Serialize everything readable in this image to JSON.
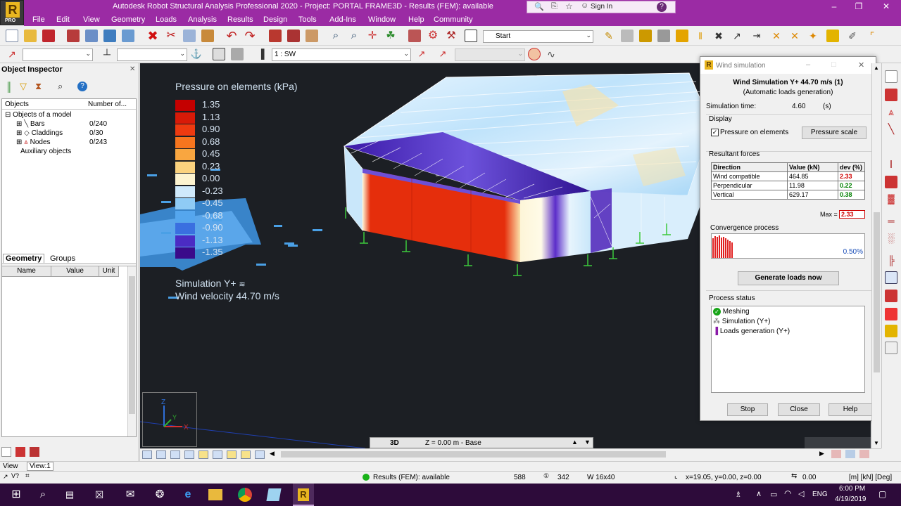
{
  "app": {
    "title": "Autodesk Robot Structural Analysis Professional 2020 - Project: PORTAL FRAME3D - Results (FEM): available",
    "logo_letter": "R",
    "logo_sub": "PRO",
    "sign_in": "Sign In",
    "accent": "#9b2ba4"
  },
  "menu": [
    "File",
    "Edit",
    "View",
    "Geometry",
    "Loads",
    "Analysis",
    "Results",
    "Design",
    "Tools",
    "Add-Ins",
    "Window",
    "Help",
    "Community"
  ],
  "toolbar": {
    "layout_combo": "Start",
    "case_combo": "1 : SW"
  },
  "object_inspector": {
    "title": "Object Inspector",
    "col_objects": "Objects",
    "col_number": "Number of...",
    "tree": [
      {
        "label": "Objects of a model",
        "count": ""
      },
      {
        "label": "Bars",
        "count": "0/240"
      },
      {
        "label": "Claddings",
        "count": "0/30"
      },
      {
        "label": "Nodes",
        "count": "0/243"
      },
      {
        "label": "Auxiliary objects",
        "count": ""
      }
    ],
    "tabs": [
      "Geometry",
      "Groups"
    ],
    "prop_headers": [
      "Name",
      "Value",
      "Unit"
    ]
  },
  "viewport": {
    "legend_title": "Pressure on elements (kPa)",
    "legend": [
      {
        "value": "1.35",
        "color": "#c40000"
      },
      {
        "value": "1.13",
        "color": "#d81a08"
      },
      {
        "value": "0.90",
        "color": "#ee3a10"
      },
      {
        "value": "0.68",
        "color": "#f7751e"
      },
      {
        "value": "0.45",
        "color": "#f9a640"
      },
      {
        "value": "0.23",
        "color": "#fbd27e"
      },
      {
        "value": "0.00",
        "color": "#fdf3cf"
      },
      {
        "value": "-0.23",
        "color": "#cfe9fb"
      },
      {
        "value": "-0.45",
        "color": "#8fcbf5"
      },
      {
        "value": "-0.68",
        "color": "#55a6ee"
      },
      {
        "value": "-0.90",
        "color": "#3a6fe0"
      },
      {
        "value": "-1.13",
        "color": "#4b2bc4"
      },
      {
        "value": "-1.35",
        "color": "#3a0a8a"
      }
    ],
    "simulation_label": "Simulation Y+",
    "velocity_label": "Wind velocity 44.70 m/s",
    "view_mode": "3D",
    "view_level": "Z = 0.00 m - Base"
  },
  "dialog": {
    "caption": "Wind simulation",
    "heading": "Wind Simulation Y+ 44.70 m/s (1)",
    "subheading": "(Automatic loads generation)",
    "sim_time_label": "Simulation time:",
    "sim_time_value": "4.60",
    "sim_time_unit": "(s)",
    "display_label": "Display",
    "pressure_checkbox": "Pressure on elements",
    "pressure_scale_btn": "Pressure scale",
    "resultant_label": "Resultant forces",
    "table_headers": [
      "Direction",
      "Value (kN)",
      "dev (%)"
    ],
    "rows": [
      {
        "dir": "Wind compatible",
        "value": "464.85",
        "dev": "2.33",
        "dev_color": "#d00000"
      },
      {
        "dir": "Perpendicular",
        "value": "11.98",
        "dev": "0.22",
        "dev_color": "#008000"
      },
      {
        "dir": "Vertical",
        "value": "629.17",
        "dev": "0.38",
        "dev_color": "#008000"
      }
    ],
    "max_label": "Max =",
    "max_value": "2.33",
    "convergence_label": "Convergence process",
    "convergence_value": "0.50%",
    "generate_btn": "Generate loads now",
    "process_status_label": "Process status",
    "status_items": [
      "Meshing",
      "Simulation (Y+)",
      "Loads generation (Y+)"
    ],
    "stop_btn": "Stop",
    "close_btn": "Close",
    "help_btn": "Help"
  },
  "statusbar": {
    "view_tab1": "View",
    "view_tab2": "View:1",
    "results": "Results (FEM): available",
    "n1": "588",
    "n2": "342",
    "section": "W 16x40",
    "coords": "x=19.05, y=0.00, z=0.00",
    "angle": "0.00",
    "units": "[m] [kN] [Deg]"
  },
  "taskbar": {
    "lang": "ENG",
    "time": "6:00 PM",
    "date": "4/19/2019"
  }
}
